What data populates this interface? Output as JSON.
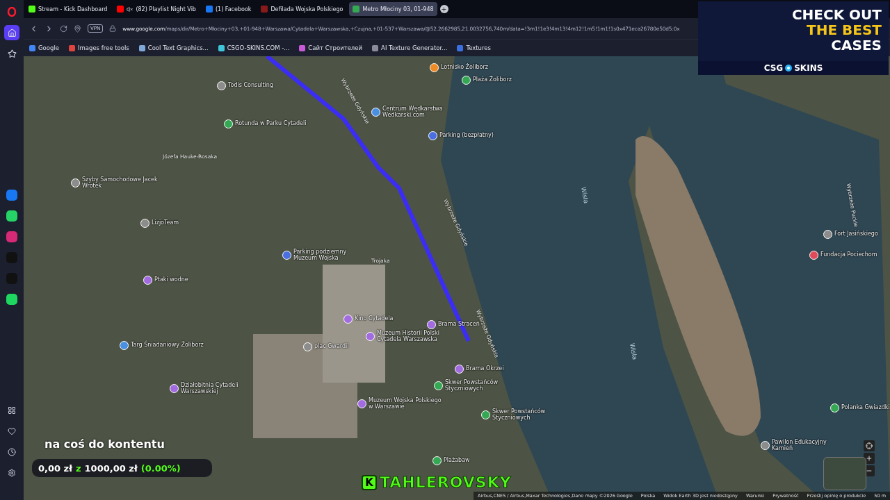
{
  "tabs": [
    {
      "label": "Stream - Kick Dashboard",
      "selected": false
    },
    {
      "label": "(82) Playlist Night Vib",
      "muted": true,
      "selected": false
    },
    {
      "label": "(1) Facebook",
      "selected": false
    },
    {
      "label": "Defilada Wojska Polskiego",
      "selected": false
    },
    {
      "label": "Metro Młociny 03, 01-948",
      "selected": true
    }
  ],
  "address_bar": {
    "vpn": "VPN",
    "url_host": "www.google.com",
    "url_path": "/maps/dir/Metro+Młociny+03,+01-948+Warszawa/Cytadela+Warszawska,+Czujna,+01-537+Warszawa/@52.2662985,21.0032756,740m/data=!3m1!1e3!4m13!4m12!1m5!1m1!1s0x471eca26780e50d5:0x"
  },
  "bookmarks": [
    {
      "label": "Google",
      "color": "#4285f4"
    },
    {
      "label": "Images free tools",
      "color": "#e0443e"
    },
    {
      "label": "Cool Text Graphics...",
      "color": "#7fa8d8"
    },
    {
      "label": "CSGO-SKINS.COM -...",
      "color": "#3fc6d8"
    },
    {
      "label": "Сайт Строителей",
      "color": "#c85ad8"
    },
    {
      "label": "AI Texture Generator...",
      "color": "#8a8a9a"
    },
    {
      "label": "Textures",
      "color": "#3b6fe0"
    }
  ],
  "sidebar": {
    "apps": [
      {
        "color": "#1877f2"
      },
      {
        "color": "#25d366"
      },
      {
        "color": "#d62976"
      },
      {
        "color": "#111111"
      },
      {
        "color": "#111111"
      },
      {
        "color": "#1ed760"
      }
    ]
  },
  "map": {
    "places": [
      {
        "label": "Todis Consulting",
        "color": "#8c8c8c"
      },
      {
        "label": "Rotunda w Parku Cytadeli",
        "color": "#34a853"
      },
      {
        "label": "Szyby Samochodowe Jacek Wrotek",
        "color": "#8c8c8c"
      },
      {
        "label": "LizjoTeam",
        "color": "#8c8c8c"
      },
      {
        "label": "Ptaki wodne",
        "color": "#a36be0"
      },
      {
        "label": "Lotnisko Żoliborz",
        "color": "#f08a24"
      },
      {
        "label": "Plaża Żoliborz",
        "color": "#34a853"
      },
      {
        "label": "Centrum Wędkarstwa Wedkarski.com",
        "color": "#4a90e2"
      },
      {
        "label": "Parking (bezpłatny)",
        "color": "#4a6fe0"
      },
      {
        "label": "Parking podziemny Muzeum Wojska",
        "color": "#4a6fe0"
      },
      {
        "label": "Kino Cytadela",
        "color": "#a36be0"
      },
      {
        "label": "Muzeum Historii Polski Cytadela Warszawska",
        "color": "#a36be0"
      },
      {
        "label": "Brama Straceń",
        "color": "#a36be0"
      },
      {
        "label": "plac Gwardii",
        "color": "#8c8c8c"
      },
      {
        "label": "Brama Okrzei",
        "color": "#a36be0"
      },
      {
        "label": "Skwer Powstańców Styczniowych",
        "color": "#34a853"
      },
      {
        "label": "Muzeum Wojska Polskiego w Warszawie",
        "color": "#a36be0"
      },
      {
        "label": "Targ Śniadaniowy Żoliborz",
        "color": "#4a90e2"
      },
      {
        "label": "Działobitnia Cytadeli Warszawskiej",
        "color": "#a36be0"
      },
      {
        "label": "Skwer Powstańców Styczniowych",
        "color": "#34a853"
      },
      {
        "label": "Plażabaw",
        "color": "#34a853"
      },
      {
        "label": "Fort Jasińskiego",
        "color": "#8c8c8c"
      },
      {
        "label": "Fundacja Pociechom",
        "color": "#e04a5a"
      },
      {
        "label": "Polanka Gwiazdki",
        "color": "#34a853"
      },
      {
        "label": "Pawilon Edukacyjny Kamień",
        "color": "#8c8c8c"
      }
    ],
    "roads": [
      "Józefa Hauke-Bosaka",
      "Wybrzeże Gdyńskie",
      "Wybrzeże Gdyńskie",
      "Wybrzeże Gdyńskie",
      "Trojaka",
      "Wybrzeże Puckie"
    ],
    "water": [
      "Wisła",
      "Wisła"
    ],
    "attribution": [
      "Airbus,CNES / Airbus,Maxar Technologies,Dane mapy ©2026 Google",
      "Polska",
      "Widok Earth 3D jest niedostępny",
      "Warunki",
      "Prywatność",
      "Prześlij opinię o produkcie",
      "50 m"
    ]
  },
  "ad": {
    "lines": [
      "CHECK OUT",
      "THE BEST",
      "CASES"
    ],
    "brand_left": "CSG",
    "brand_right": "SKINS"
  },
  "goal": {
    "title": "na coś do kontentu",
    "current": "0,00 zł",
    "separator": "z",
    "target": "1000,00 zł",
    "percent": "(0.00%)",
    "level": 0
  },
  "streamer": {
    "badge": "K",
    "name": "TAHLEROVSKY"
  }
}
